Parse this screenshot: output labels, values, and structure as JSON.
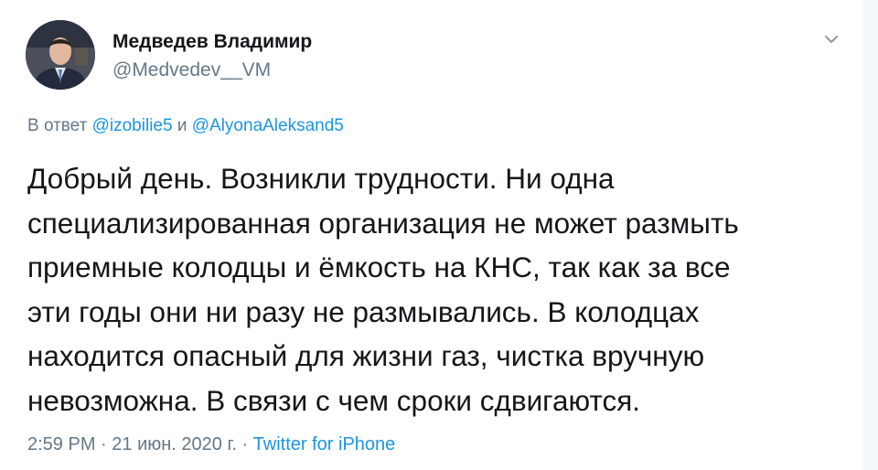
{
  "author": {
    "display_name": "Медведев Владимир",
    "handle": "@Medvedev__VM"
  },
  "reply_context": {
    "prefix": "В ответ",
    "mention_1": "@izobilie5",
    "conjunction": "и",
    "mention_2": "@AlyonaAleksand5"
  },
  "tweet": {
    "lines": [
      "Добрый день. Возникли трудности. Ни одна",
      "специализированная организация не может размыть",
      "приемные колодцы и ёмкость на КНС, так как за все",
      "эти годы они ни разу не размывались. В колодцах",
      "находится опасный для жизни газ, чистка вручную",
      "невозможна. В связи с чем сроки сдвигаются."
    ]
  },
  "meta": {
    "time": "2:59 PM",
    "separator": "·",
    "date": "21 июн. 2020 г.",
    "source": "Twitter for iPhone"
  },
  "icons": {
    "menu": "chevron-down-icon"
  },
  "colors": {
    "text": "#14171a",
    "secondary": "#657786",
    "link": "#1b95e0"
  }
}
